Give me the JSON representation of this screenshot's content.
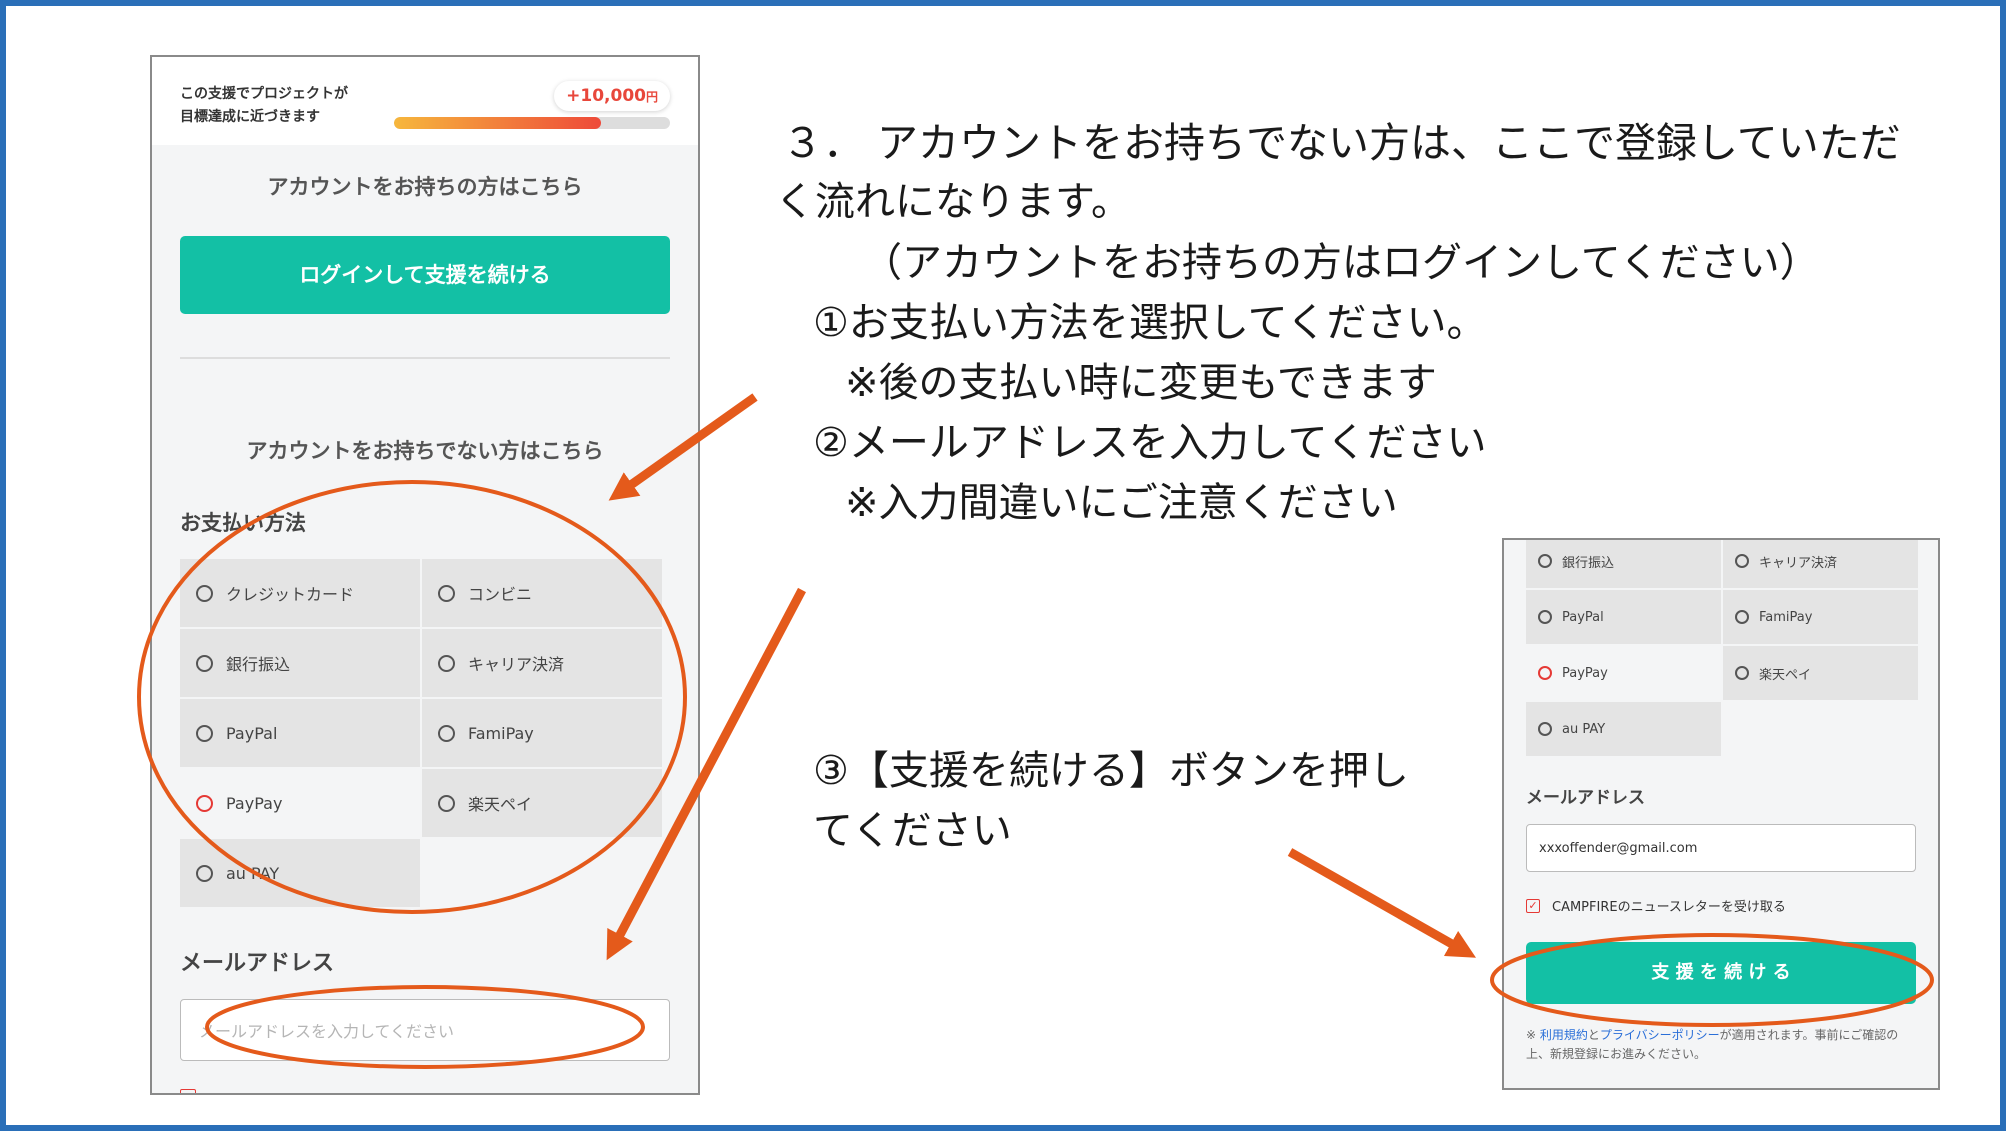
{
  "phone1": {
    "goal_text_line1": "この支援でプロジェクトが",
    "goal_text_line2": "目標達成に近づきます",
    "goal_amount": "+10,000",
    "goal_unit": "円",
    "goal_progress_fraction": 0.75,
    "have_account_heading": "アカウントをお持ちの方はこちら",
    "login_button": "ログインして支援を続ける",
    "no_account_heading": "アカウントをお持ちでない方はこちら",
    "payment_label": "お支払い方法",
    "payment_options": [
      {
        "label": "クレジットカード",
        "selected": false
      },
      {
        "label": "コンビニ",
        "selected": false
      },
      {
        "label": "銀行振込",
        "selected": false
      },
      {
        "label": "キャリア決済",
        "selected": false
      },
      {
        "label": "PayPal",
        "selected": false
      },
      {
        "label": "FamiPay",
        "selected": false
      },
      {
        "label": "PayPay",
        "selected": true
      },
      {
        "label": "楽天ペイ",
        "selected": false
      },
      {
        "label": "au PAY",
        "selected": false
      }
    ],
    "email_label": "メールアドレス",
    "email_placeholder": "メールアドレスを入力してください"
  },
  "phone2": {
    "payment_options": [
      {
        "label": "銀行振込",
        "selected": false
      },
      {
        "label": "キャリア決済",
        "selected": false
      },
      {
        "label": "PayPal",
        "selected": false
      },
      {
        "label": "FamiPay",
        "selected": false
      },
      {
        "label": "PayPay",
        "selected": true
      },
      {
        "label": "楽天ペイ",
        "selected": false
      },
      {
        "label": "au PAY",
        "selected": false
      }
    ],
    "email_label": "メールアドレス",
    "email_value": "xxxoffender@gmail.com",
    "newsletter_label": "CAMPFIREのニュースレターを受け取る",
    "newsletter_checked": true,
    "submit_button": "支 援 を 続 け る",
    "terms_prefix": "※ ",
    "terms_link": "利用規約",
    "terms_and": "と",
    "privacy_link": "プライバシーポリシー",
    "terms_line1_rest": "が適用されます。事前にご確認の",
    "terms_line2": "上、新規登録にお進みください。"
  },
  "instructions": {
    "line1": "３．  アカウントをお持ちでない方は、ここで登録していただ",
    "line2": "く流れになります。",
    "line3": "（アカウントをお持ちの方はログインしてください）",
    "line4": "①お支払い方法を選択してください。",
    "line5": "※後の支払い時に変更もできます",
    "line6": "②メールアドレスを入力してください",
    "line7": "※入力間違いにご注意ください",
    "step3_line1": "③【支援を続ける】ボタンを押し",
    "step3_line2": "てください"
  },
  "colors": {
    "frame": "#2a6fb8",
    "accent_teal": "#13c0a5",
    "annotation_orange": "#e45a1b",
    "selected_red": "#e53935",
    "link_blue": "#2a6fd8"
  },
  "icons": [
    "radio-icon",
    "checkbox-icon",
    "arrow-icon"
  ]
}
